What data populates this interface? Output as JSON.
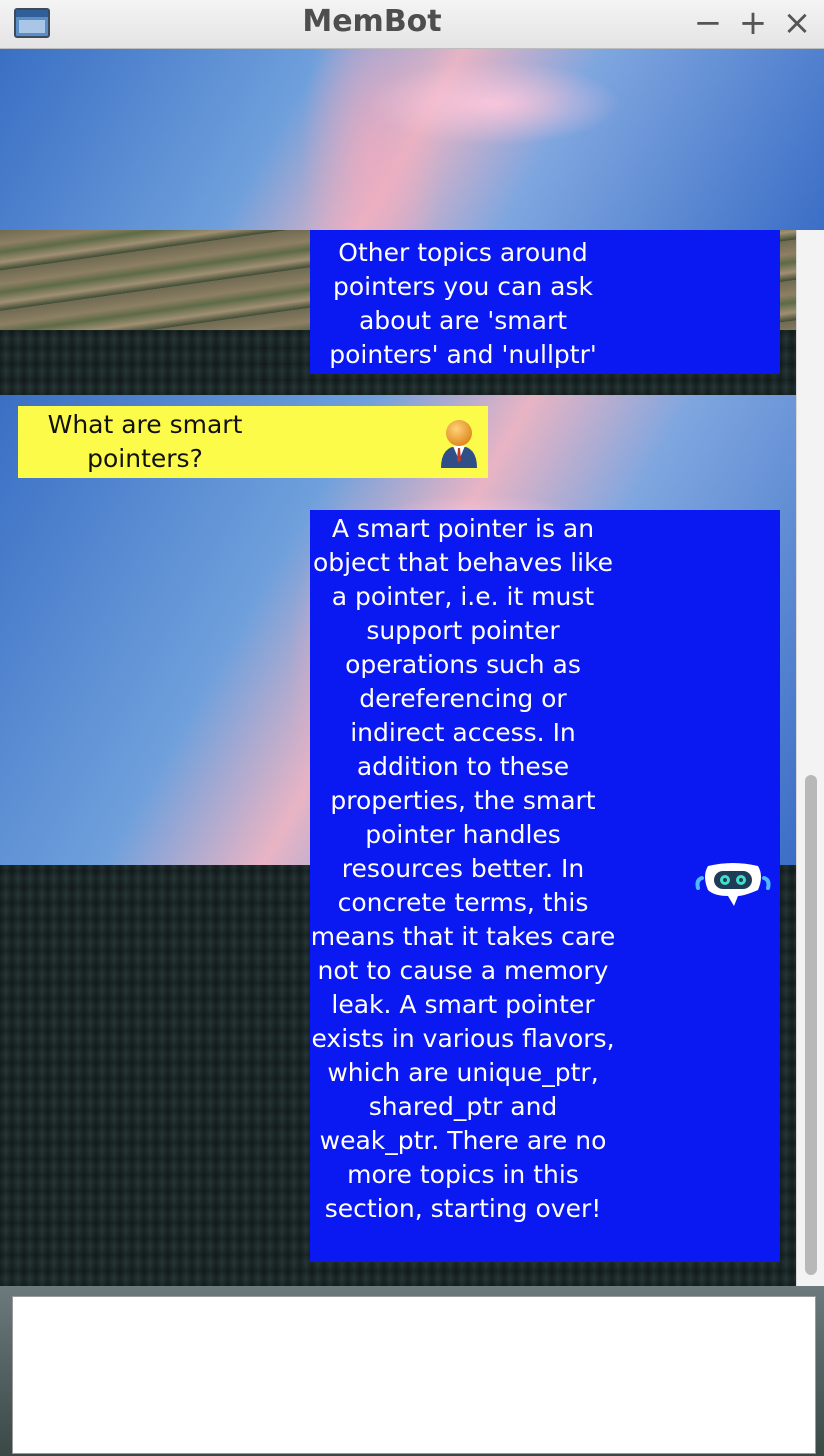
{
  "window": {
    "title": "MemBot",
    "controls": {
      "minimize": "−",
      "maximize": "+",
      "close": "×"
    }
  },
  "chat": {
    "messages": [
      {
        "sender": "bot",
        "text": "Other topics around pointers you can ask about are 'smart pointers' and 'nullptr'"
      },
      {
        "sender": "user",
        "text": "What are smart pointers?"
      },
      {
        "sender": "bot",
        "text": "A smart pointer is an object that behaves like a pointer, i.e. it must support pointer operations such as dereferencing or indirect access. In addition to these properties, the smart pointer handles resources better. In concrete terms, this means that it takes care not to cause a memory leak. A smart pointer exists in various flavors, which are unique_ptr, shared_ptr and weak_ptr. There are no more topics in this section, starting over!"
      }
    ],
    "icons": {
      "user": "user-avatar-icon",
      "bot": "robot-icon"
    }
  },
  "input": {
    "value": ""
  },
  "colors": {
    "bot_bubble": "#0a18f2",
    "user_bubble": "#fdfb4a",
    "bot_text": "#ffffff",
    "user_text": "#111111"
  }
}
